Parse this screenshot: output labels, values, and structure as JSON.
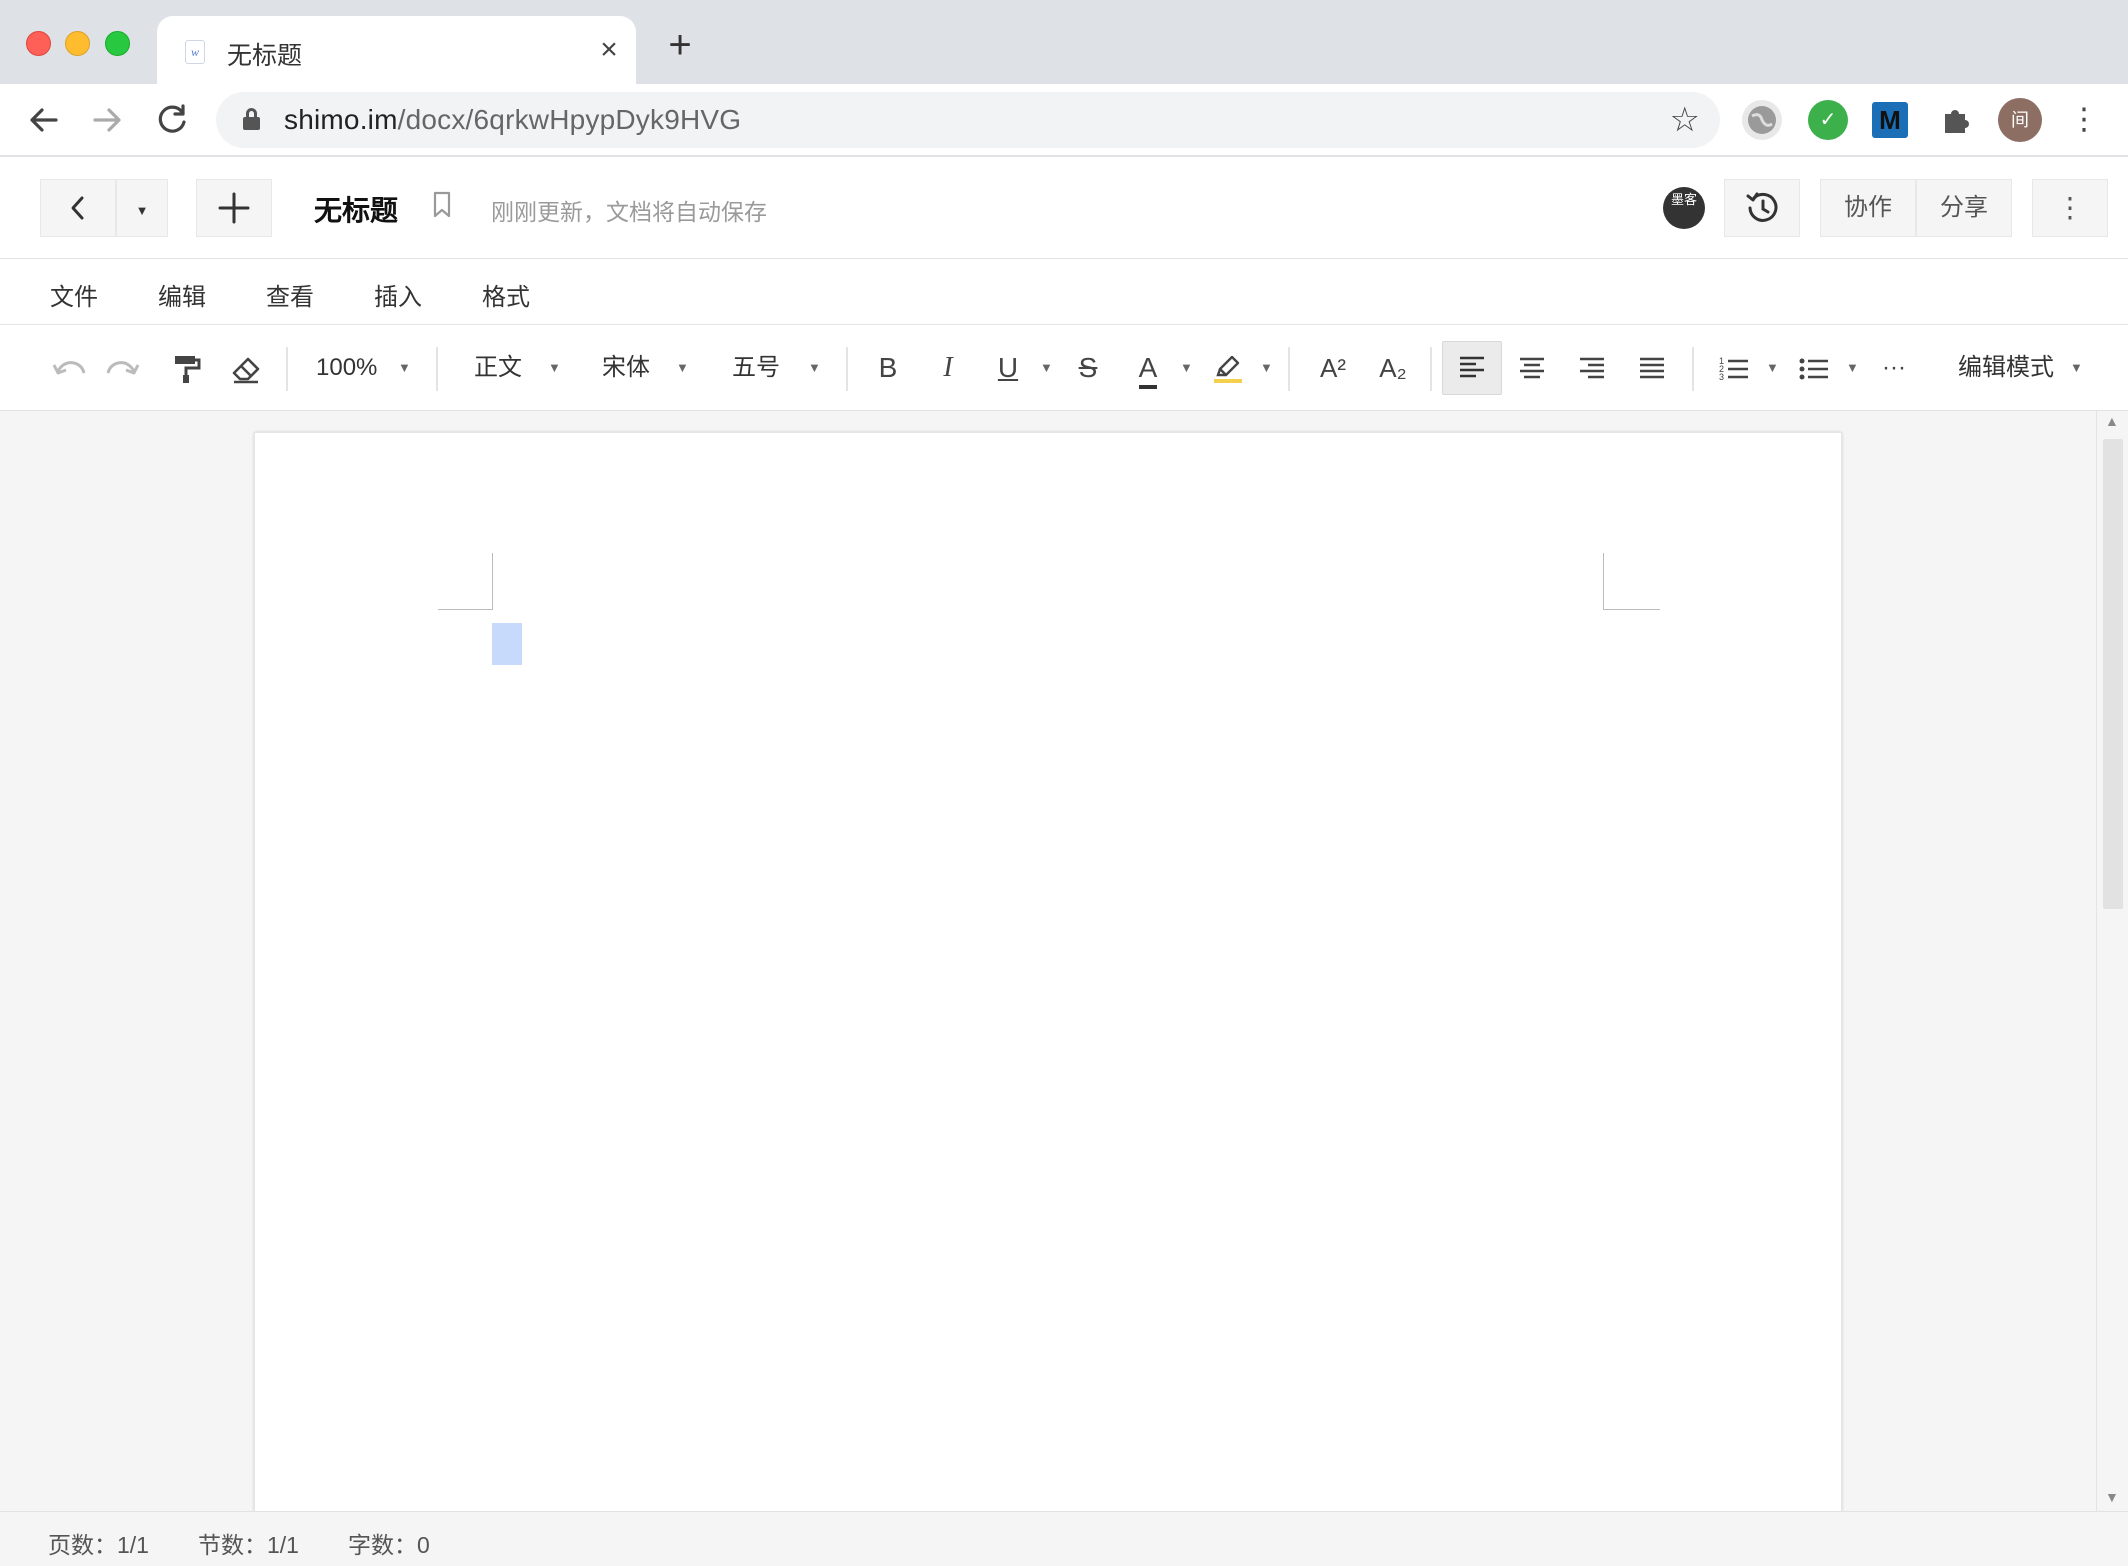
{
  "browser": {
    "tab": {
      "title": "无标题",
      "favicon": "w",
      "close": "×"
    },
    "new_tab": "+",
    "url_host": "shimo.im",
    "url_path": "/docx/6qrkwHpypDyk9HVG",
    "extensions": [
      {
        "name": "globe-extension-icon",
        "label": ""
      },
      {
        "name": "green-extension-icon",
        "label": "✓"
      },
      {
        "name": "m-extension-icon",
        "label": "M"
      },
      {
        "name": "puzzle-extensions-icon",
        "label": ""
      },
      {
        "name": "profile-avatar",
        "label": "间"
      }
    ]
  },
  "header": {
    "title": "无标题",
    "save_status": "刚刚更新，文档将自动保存",
    "avatar_text": "墨客",
    "collab_label": "协作",
    "share_label": "分享"
  },
  "menu": [
    "文件",
    "编辑",
    "查看",
    "插入",
    "格式"
  ],
  "toolbar": {
    "zoom": "100%",
    "paragraph_style": "正文",
    "font": "宋体",
    "font_size": "五号",
    "bold": "B",
    "italic": "I",
    "underline": "U",
    "strike": "S",
    "font_color": "A",
    "superscript": "A²",
    "subscript": "A₂",
    "more": "···",
    "mode": "编辑模式"
  },
  "status": {
    "pages": "页数：1/1",
    "sections": "节数：1/1",
    "words": "字数：0"
  },
  "colors": {
    "cursor_highlight": "#c8dafb",
    "highlight_underline": "#f5d04e"
  }
}
